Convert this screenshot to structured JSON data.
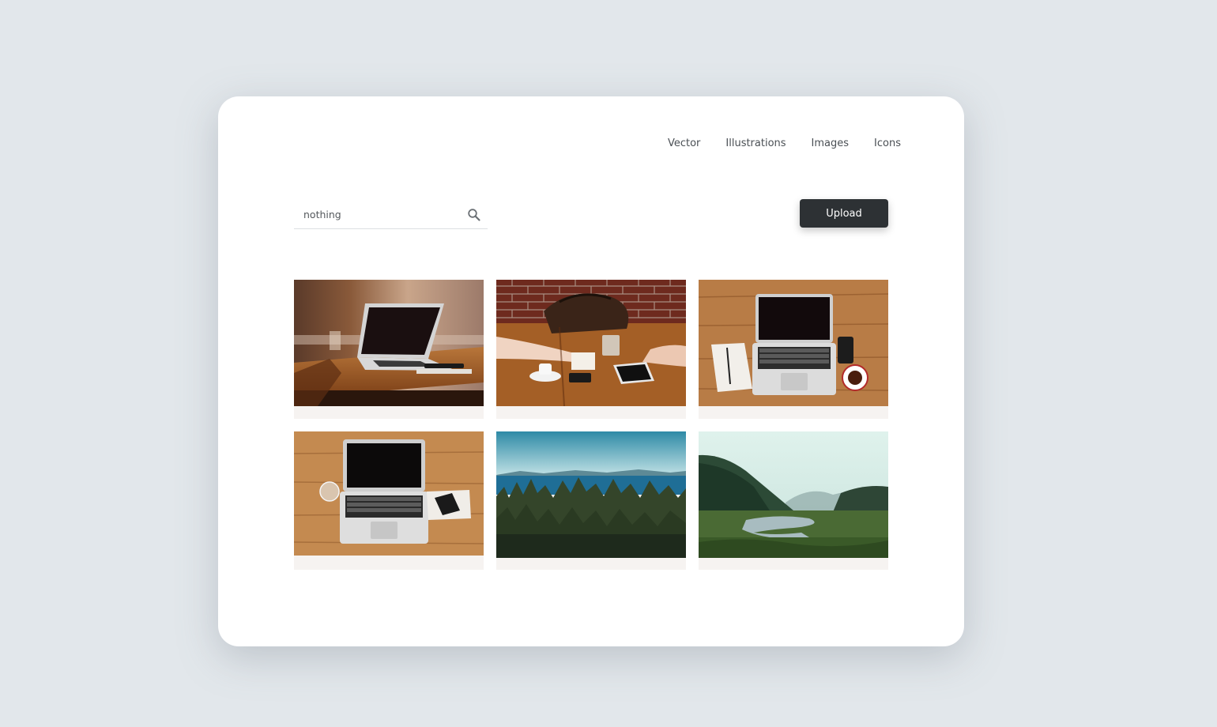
{
  "nav": {
    "items": [
      "Vector",
      "Illustrations",
      "Images",
      "Icons"
    ]
  },
  "search": {
    "value": "nothing",
    "icon": "search-icon"
  },
  "upload": {
    "label": "Upload"
  },
  "gallery": {
    "items": [
      {
        "alt": "laptop on cafe table"
      },
      {
        "alt": "people working at wooden table with bag"
      },
      {
        "alt": "laptop top view with notebook and coffee"
      },
      {
        "alt": "laptop top view with glass and phone"
      },
      {
        "alt": "forest overlooking lake"
      },
      {
        "alt": "misty valley with stream"
      }
    ]
  },
  "colors": {
    "background": "#e2e7eb",
    "card": "#ffffff",
    "button": "#2d3134",
    "tile_base": "#f6f3f1"
  }
}
